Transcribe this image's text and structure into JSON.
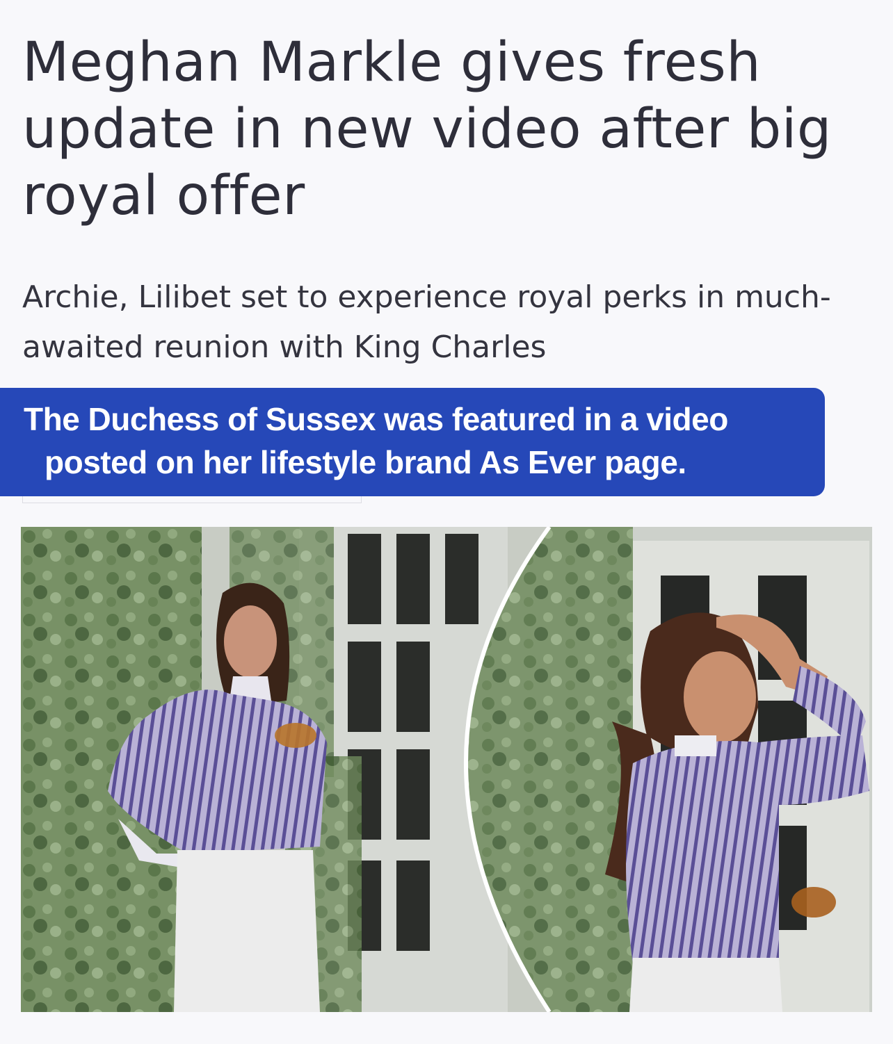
{
  "article": {
    "headline": "Meghan Markle gives fresh update in new video after big royal offer",
    "standfirst": "Archie, Lilibet set to experience royal perks in much-awaited reunion with King Charles",
    "caption": {
      "line1": "The Duchess of Sussex was featured in a video",
      "line2": "posted on her lifestyle brand As Ever page."
    }
  },
  "colors": {
    "background": "#f8f8fb",
    "headline_text": "#2e2e3a",
    "caption_banner": "#2648b8",
    "caption_text": "#ffffff"
  }
}
